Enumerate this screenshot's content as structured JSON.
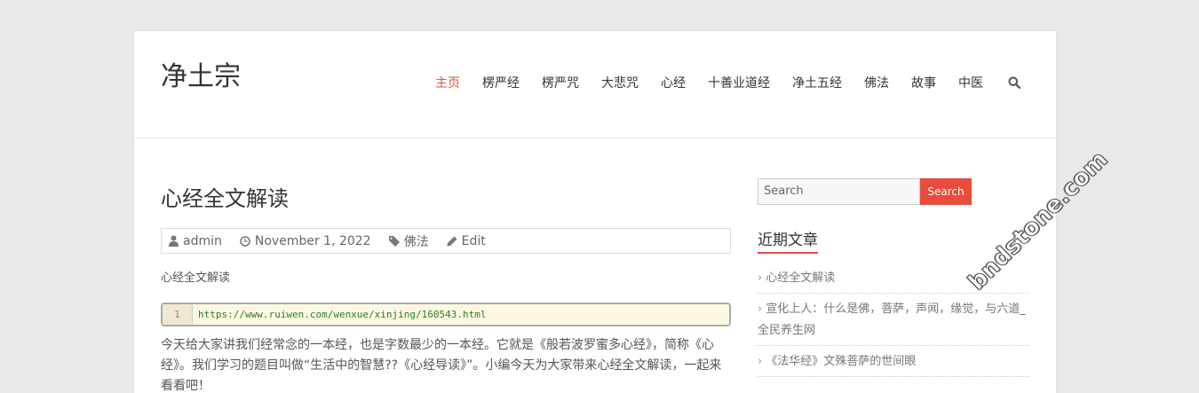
{
  "site": {
    "title": "净土宗"
  },
  "nav": {
    "items": [
      "主页",
      "楞严经",
      "楞严咒",
      "大悲咒",
      "心经",
      "十善业道经",
      "净土五经",
      "佛法",
      "故事",
      "中医"
    ],
    "active_index": 0
  },
  "post": {
    "title": "心经全文解读",
    "meta": {
      "author": "admin",
      "date": "November 1, 2022",
      "category": "佛法",
      "edit": "Edit"
    },
    "excerpt": "心经全文解读",
    "code": {
      "line_number": "1",
      "url": "https://www.ruiwen.com/wenxue/xinjing/160543.html"
    },
    "body": "今天给大家讲我们经常念的一本经，也是字数最少的一本经。它就是《般若波罗蜜多心经》，简称《心经》。我们学习的题目叫做“生活中的智慧??《心经导读》”。小编今天为大家带来心经全文解读，一起来看看吧！"
  },
  "sidebar": {
    "search": {
      "placeholder": "Search",
      "button": "Search"
    },
    "recent_title": "近期文章",
    "recent": [
      "心经全文解读",
      "宣化上人：什么是佛，菩萨，声闻，缘觉，与六道_全民养生网",
      "《法华经》文殊菩萨的世间眼"
    ]
  },
  "watermark": "bndstone.com",
  "colors": {
    "accent": "#e74c3c",
    "background": "#e9e9e9"
  },
  "icons": [
    "user-icon",
    "clock-icon",
    "tag-icon",
    "pencil-icon",
    "search-icon",
    "chevron-right-icon"
  ]
}
